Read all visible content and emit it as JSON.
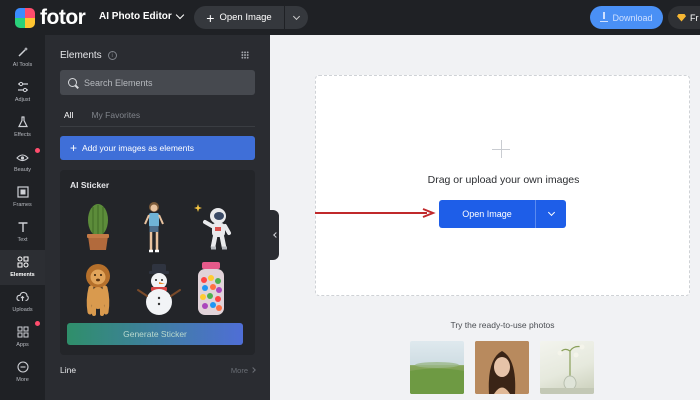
{
  "topbar": {
    "logo_text": "fotor",
    "editor_menu": "AI Photo Editor",
    "open_image": "Open Image",
    "download": "Download",
    "pro_label": "Fr"
  },
  "rail": {
    "items": [
      {
        "label": "AI Tools",
        "icon": "ai-tools-icon"
      },
      {
        "label": "Adjust",
        "icon": "sliders-icon"
      },
      {
        "label": "Effects",
        "icon": "flask-icon"
      },
      {
        "label": "Beauty",
        "icon": "eye-icon"
      },
      {
        "label": "Frames",
        "icon": "frame-icon"
      },
      {
        "label": "Text",
        "icon": "text-icon"
      },
      {
        "label": "Elements",
        "icon": "shapes-icon"
      },
      {
        "label": "Uploads",
        "icon": "cloud-upload-icon"
      },
      {
        "label": "Apps",
        "icon": "apps-icon"
      },
      {
        "label": "More",
        "icon": "more-icon"
      }
    ],
    "active": "Elements"
  },
  "panel": {
    "title": "Elements",
    "search_placeholder": "Search Elements",
    "tabs": [
      "All",
      "My Favorites"
    ],
    "add_button": "Add your images as elements",
    "sticker_title": "AI Sticker",
    "stickers": [
      "cactus",
      "girl",
      "astronaut",
      "lion",
      "snowman",
      "candy-jar"
    ],
    "generate_button": "Generate Sticker",
    "line_section": "Line",
    "more_link": "More"
  },
  "canvas": {
    "drop_text": "Drag or upload your own images",
    "open_button": "Open Image",
    "ready_label": "Try the ready-to-use photos",
    "sample_photos": [
      "landscape",
      "portrait",
      "still-life"
    ]
  },
  "colors": {
    "accent": "#1e5ee8",
    "dark_bg": "#1f2125",
    "panel_bg": "#2a2c31",
    "arrow": "#c0292b"
  }
}
